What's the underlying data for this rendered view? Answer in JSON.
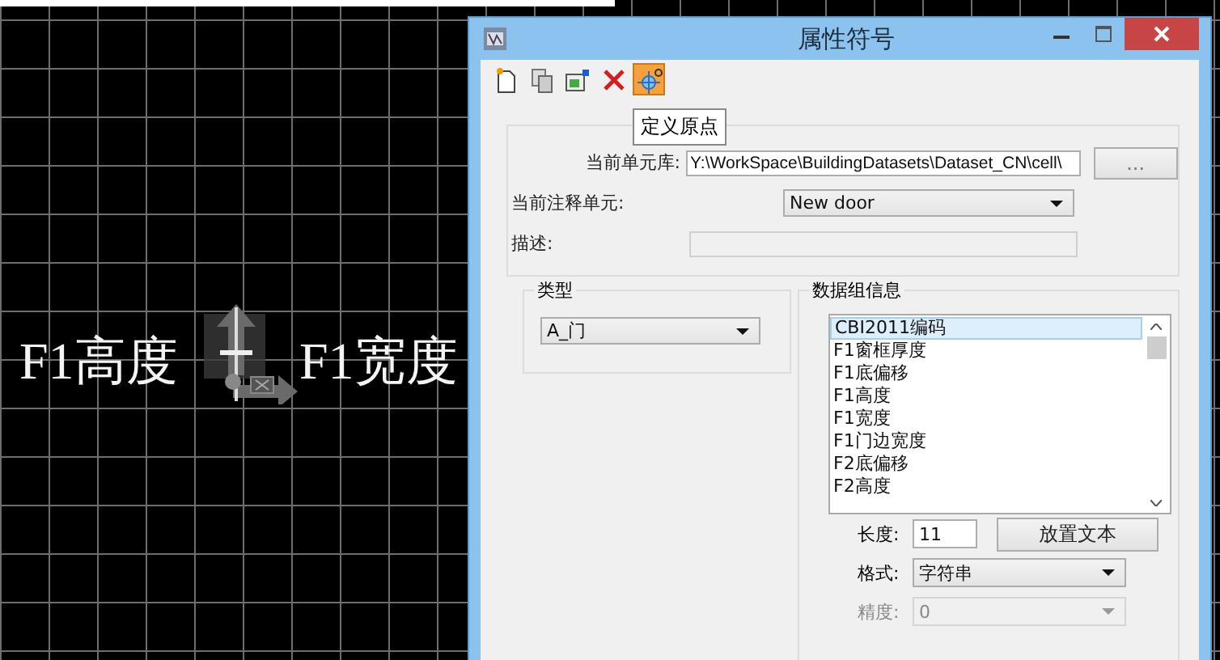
{
  "canvas": {
    "labels": [
      {
        "text": "F1高度"
      },
      {
        "text": "F1宽度"
      }
    ]
  },
  "dialog": {
    "title": "属性符号",
    "toolbar": [
      {
        "kind": "new",
        "selected": false
      },
      {
        "kind": "copy",
        "selected": false
      },
      {
        "kind": "edit",
        "selected": false
      },
      {
        "kind": "delete",
        "selected": false
      },
      {
        "kind": "origin",
        "selected": true
      }
    ],
    "tooltip": "定义原点",
    "cell_library": {
      "label": "当前单元库:",
      "value": "Y:\\WorkSpace\\BuildingDatasets\\Dataset_CN\\cell\\",
      "button": "..."
    },
    "annotation_cell": {
      "label": "当前注释单元:",
      "value": "New door"
    },
    "description": {
      "label": "描述:"
    },
    "type_group": {
      "title": "类型",
      "value": "A_门"
    },
    "data_group": {
      "title": "数据组信息",
      "items": [
        {
          "text": "CBI2011编码",
          "selected": true
        },
        {
          "text": "F1窗框厚度",
          "selected": false
        },
        {
          "text": "F1底偏移",
          "selected": false
        },
        {
          "text": "F1高度",
          "selected": false
        },
        {
          "text": "F1宽度",
          "selected": false
        },
        {
          "text": "F1门边宽度",
          "selected": false
        },
        {
          "text": "F2底偏移",
          "selected": false
        },
        {
          "text": "F2高度",
          "selected": false
        }
      ],
      "length": {
        "label": "长度:",
        "value": "11"
      },
      "place_button": "放置文本",
      "format": {
        "label": "格式:",
        "value": "字符串",
        "disabled": false
      },
      "precision": {
        "label": "精度:",
        "value": "0",
        "disabled": true
      }
    }
  }
}
